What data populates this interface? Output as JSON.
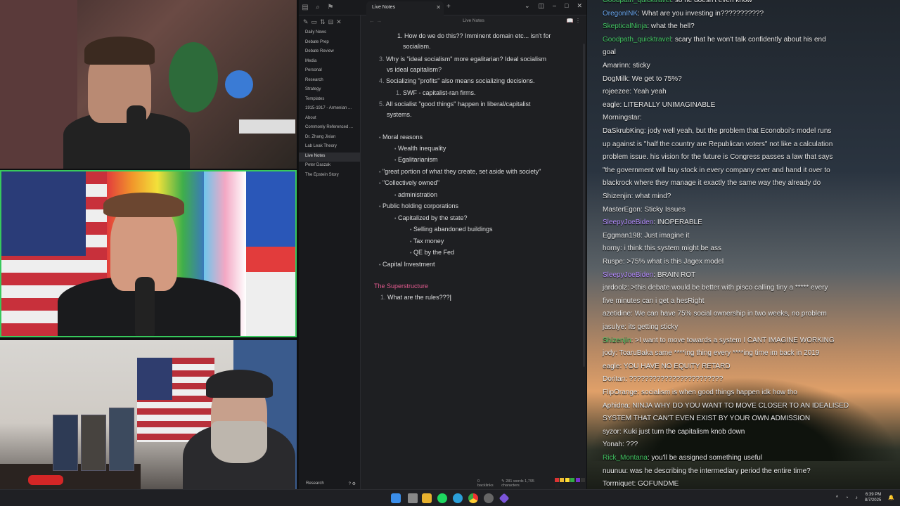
{
  "obsidian": {
    "tab_title": "Live Notes",
    "editor_title": "Live Notes",
    "sidebar_items": [
      "Daily News",
      "Debate Prep",
      "Debate Review",
      "Media",
      "Personal",
      "Research",
      "Strategy",
      "Templates",
      "1915-1917 - Armenian ...",
      "About",
      "Commonly Referenced ...",
      "Dr. Zhang Jixian",
      "Lab Leak Theory",
      "Live Notes",
      "Peter Daszak",
      "The Epstein Story"
    ],
    "active_item": "Live Notes",
    "vault_name": "Research",
    "notes": {
      "l0": "1. How do we do this?? Imminent domain etc... isn't for",
      "l0b": "socialism.",
      "l1n": "3.",
      "l1": "Why is \"ideal socialism\" more egalitarian? Ideal socialism",
      "l1b": "vs ideal capitalism?",
      "l2n": "4.",
      "l2": "Socializing \"profits\" also means socializing decisions.",
      "l3n": "1.",
      "l3": "SWF - capitalist-ran firms.",
      "l4n": "5.",
      "l4": "All socialist \"good things\" happen in liberal/capitalist",
      "l4b": "systems.",
      "b1": "Moral reasons",
      "b2": "Wealth inequality",
      "b3": "Egalitarianism",
      "b4": "\"great portion of what they create, set aside with society\"",
      "b5": "\"Collectively owned\"",
      "b6": "administration",
      "b7": "Public holding corporations",
      "b8": "Capitalized by the state?",
      "b9": "Selling abandoned buildings",
      "b10": "Tax money",
      "b11": "QE by the Fed",
      "b12": "Capital Investment",
      "heading": "The Superstructure",
      "q1n": "1.",
      "q1": "What are the rules???"
    },
    "status": {
      "backlinks": "0 backlinks",
      "words": "281 words",
      "chars": "1,795 characters"
    }
  },
  "chat": [
    {
      "user": "Goodpath_quicktravel",
      "color": "#43c463",
      "text": ": so he doesn't even know"
    },
    {
      "user": "OregonINK",
      "color": "#6aa8f0",
      "text": ": What are you investing in???????????"
    },
    {
      "user": "SkepticalNinja",
      "color": "#43c463",
      "text": ": what the hell?"
    },
    {
      "user": "Goodpath_quicktravel",
      "color": "#43c463",
      "text": ": scary that he won't talk confidently about his end"
    },
    {
      "user": "",
      "color": "#e9e9e9",
      "text": "goal",
      "wrap": true
    },
    {
      "user": "Amarinn",
      "color": "#e9e9e9",
      "text": ": sticky"
    },
    {
      "user": "DogMilk",
      "color": "#e9e9e9",
      "text": ": We get to 75%?"
    },
    {
      "user": "rojeezee",
      "color": "#e9e9e9",
      "text": ": Yeah yeah"
    },
    {
      "user": "eagle",
      "color": "#e9e9e9",
      "text": ": LITERALLY UNIMAGINABLE"
    },
    {
      "user": "Morningstar",
      "color": "#e9e9e9",
      "text": ":"
    },
    {
      "user": "DaSkrubKing",
      "color": "#e9e9e9",
      "text": ": jody well yeah, but the problem that Econoboi's model runs"
    },
    {
      "user": "",
      "color": "#e9e9e9",
      "text": "up against is \"half the country are Republican voters\" not like a calculation",
      "wrap": true
    },
    {
      "user": "",
      "color": "#e9e9e9",
      "text": "problem issue. his vision for the future is Congress passes a law that says",
      "wrap": true
    },
    {
      "user": "",
      "color": "#e9e9e9",
      "text": "\"the government will buy stock in every company ever and hand it over to",
      "wrap": true
    },
    {
      "user": "",
      "color": "#e9e9e9",
      "text": "blackrock where they manage it exactly the same way they already do",
      "wrap": true
    },
    {
      "user": "Shizenjin",
      "color": "#e9e9e9",
      "text": ": what mind?"
    },
    {
      "user": "MasterEgon",
      "color": "#e9e9e9",
      "text": ": Sticky Issues"
    },
    {
      "user": "SleepyJoeBiden",
      "color": "#b58cff",
      "text": ": INOPERABLE"
    },
    {
      "user": "Eggman198",
      "color": "#e9e9e9",
      "text": ": Just imagine it"
    },
    {
      "user": "horny",
      "color": "#e9e9e9",
      "text": ": i think this system might be ass"
    },
    {
      "user": "Ruspe",
      "color": "#e9e9e9",
      "text": ": >75% what is this Jagex model"
    },
    {
      "user": "SleepyJoeBiden",
      "color": "#b58cff",
      "text": ": BRAIN ROT"
    },
    {
      "user": "jardoolz",
      "color": "#e9e9e9",
      "text": ": >this debate would be better with pisco calling tiny a ***** every"
    },
    {
      "user": "",
      "color": "#e9e9e9",
      "text": "five minutes can i get a hesRight",
      "wrap": true
    },
    {
      "user": "azetidine",
      "color": "#e9e9e9",
      "text": ": We can have 75% social ownership in two weeks, no problem"
    },
    {
      "user": "jasulye",
      "color": "#e9e9e9",
      "text": ": its getting sticky"
    },
    {
      "user": "Shizenjin",
      "color": "#43c463",
      "text": ": >I want to move towards a system I CANT IMAGINE WORKING"
    },
    {
      "user": "jody",
      "color": "#e9e9e9",
      "text": ": ToaruBaka same ****ing thing every ****ing time im back in 2019"
    },
    {
      "user": "eagle",
      "color": "#e9e9e9",
      "text": ": YOU HAVE NO EQUITY RETARD"
    },
    {
      "user": "Doritan",
      "color": "#e9e9e9",
      "text": ": ????????????????????????"
    },
    {
      "user": "FlipOrange",
      "color": "#e9e9e9",
      "text": ": socialism is when good things happen idk how tho"
    },
    {
      "user": "Aphidna",
      "color": "#e9e9e9",
      "text": ": NINJA WHY DO YOU WANT TO MOVE CLOSER TO AN IDEALISED"
    },
    {
      "user": "",
      "color": "#e9e9e9",
      "text": "SYSTEM THAT CAN'T EVEN EXIST BY YOUR OWN ADMISSION",
      "wrap": true
    },
    {
      "user": "syzor",
      "color": "#e9e9e9",
      "text": ": Kuki just turn the capitalism knob down"
    },
    {
      "user": "Yonah",
      "color": "#e9e9e9",
      "text": ": ???"
    },
    {
      "user": "Rick_Montana",
      "color": "#43c463",
      "text": ": you'll be assigned something useful"
    },
    {
      "user": "nuunuu",
      "color": "#e9e9e9",
      "text": ": was he describing the intermediary period the entire time?"
    },
    {
      "user": "Torrniquet",
      "color": "#e9e9e9",
      "text": ": GOFUNDME"
    }
  ],
  "clock": {
    "time": "6:39 PM",
    "date": "8/7/2025"
  },
  "icons": [
    "search-icon",
    "spotify-icon",
    "edge-icon",
    "chrome-icon",
    "obsidian-icon",
    "windows-start-icon"
  ]
}
